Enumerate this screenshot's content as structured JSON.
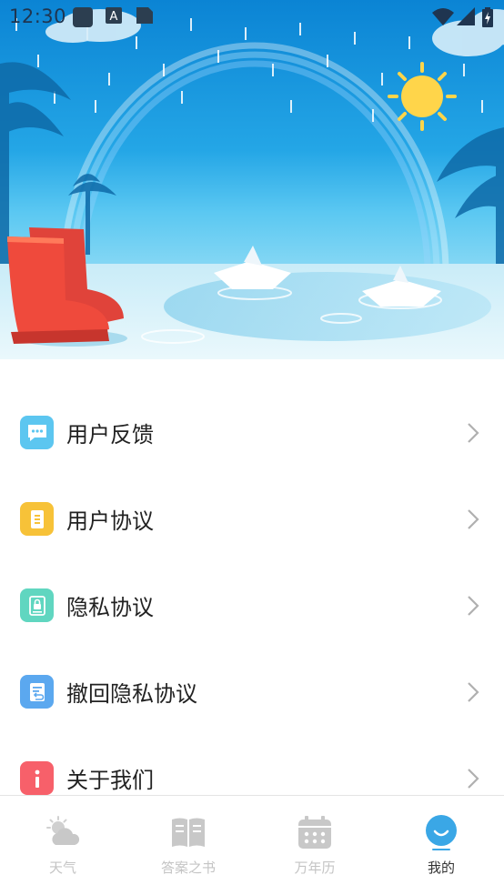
{
  "status_bar": {
    "time": "12:30"
  },
  "menu": {
    "items": [
      {
        "label": "用户反馈",
        "icon": "chat-bubble-icon",
        "color": "#5cc6f0"
      },
      {
        "label": "用户协议",
        "icon": "document-icon",
        "color": "#f7c238"
      },
      {
        "label": "隐私协议",
        "icon": "lock-document-icon",
        "color": "#60d6c0"
      },
      {
        "label": "撤回隐私协议",
        "icon": "revoke-document-icon",
        "color": "#5ba8ef"
      },
      {
        "label": "关于我们",
        "icon": "info-icon",
        "color": "#f7606a"
      }
    ]
  },
  "bottom_nav": {
    "tabs": [
      {
        "label": "天气",
        "icon": "weather-icon",
        "active": false
      },
      {
        "label": "答案之书",
        "icon": "book-icon",
        "active": false
      },
      {
        "label": "万年历",
        "icon": "calendar-icon",
        "active": false
      },
      {
        "label": "我的",
        "icon": "profile-icon",
        "active": true
      }
    ]
  },
  "colors": {
    "sky_top": "#0a86d6",
    "sky_bottom": "#4fc4f0",
    "water": "#d7f1f8",
    "active_tab": "#3aa7e6",
    "inactive_tab": "#c4c4c4"
  }
}
